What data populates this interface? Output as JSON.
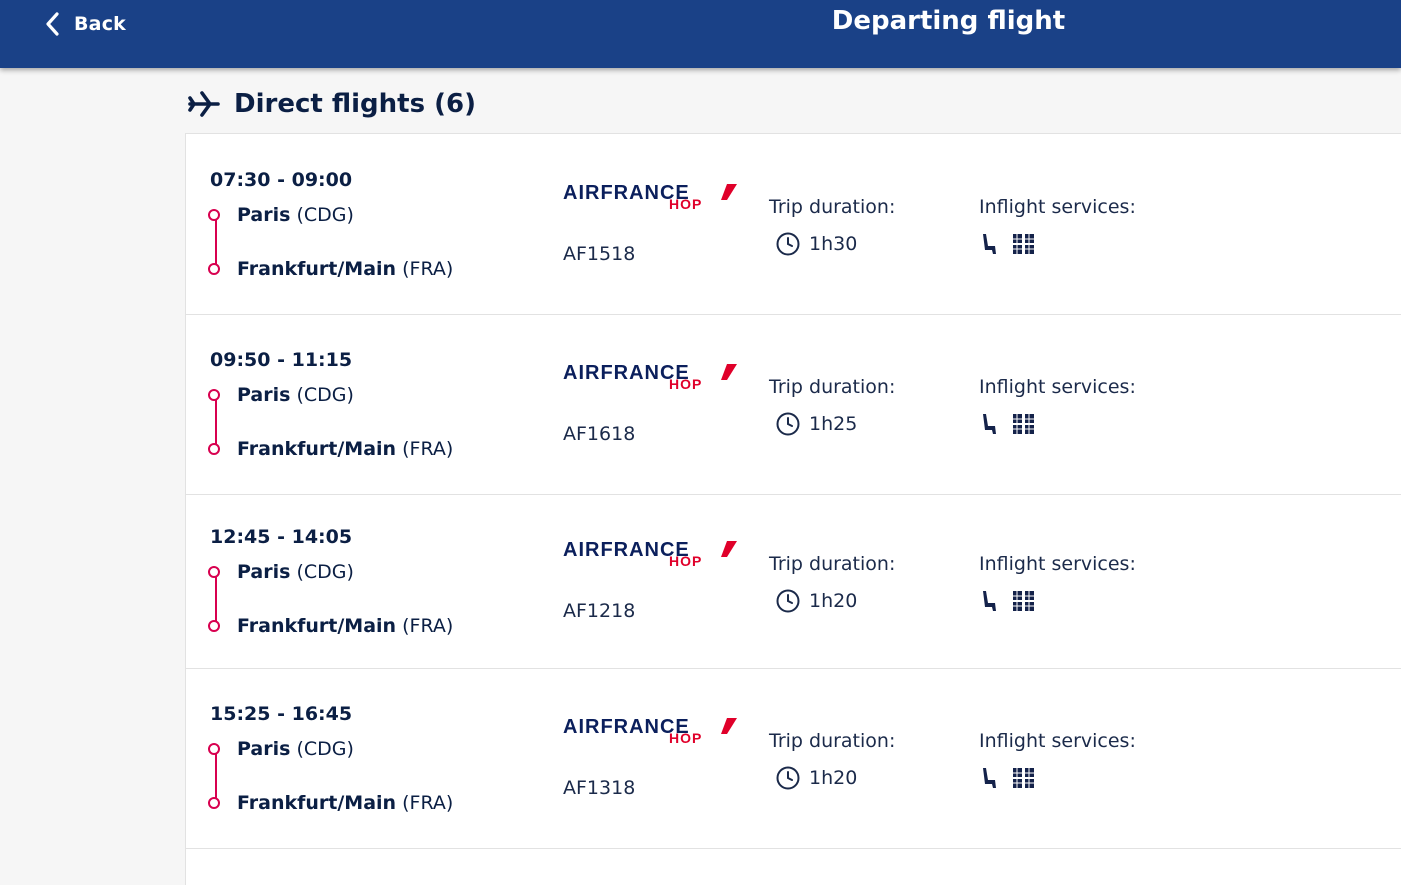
{
  "header": {
    "back_label": "Back",
    "title": "Departing flight"
  },
  "section": {
    "title": "Direct flights (6)",
    "icon": "plane-icon"
  },
  "airline": {
    "name_top": "AIRFRANCE",
    "name_sub": "HOP"
  },
  "labels": {
    "trip_duration": "Trip duration:",
    "inflight_services": "Inflight services:"
  },
  "flights": [
    {
      "times": "07:30 - 09:00",
      "from_city": "Paris",
      "from_code": "(CDG)",
      "to_city": "Frankfurt/Main",
      "to_code": "(FRA)",
      "flight_no": "AF1518",
      "duration": "1h30"
    },
    {
      "times": "09:50 - 11:15",
      "from_city": "Paris",
      "from_code": "(CDG)",
      "to_city": "Frankfurt/Main",
      "to_code": "(FRA)",
      "flight_no": "AF1618",
      "duration": "1h25"
    },
    {
      "times": "12:45 - 14:05",
      "from_city": "Paris",
      "from_code": "(CDG)",
      "to_city": "Frankfurt/Main",
      "to_code": "(FRA)",
      "flight_no": "AF1218",
      "duration": "1h20"
    },
    {
      "times": "15:25 - 16:45",
      "from_city": "Paris",
      "from_code": "(CDG)",
      "to_city": "Frankfurt/Main",
      "to_code": "(FRA)",
      "flight_no": "AF1318",
      "duration": "1h20"
    }
  ],
  "services_icons": [
    "seat-icon",
    "meal-icon"
  ],
  "colors": {
    "header_bg": "#1a4187",
    "route_accent": "#d8004f",
    "text_dark": "#0b1f44"
  }
}
